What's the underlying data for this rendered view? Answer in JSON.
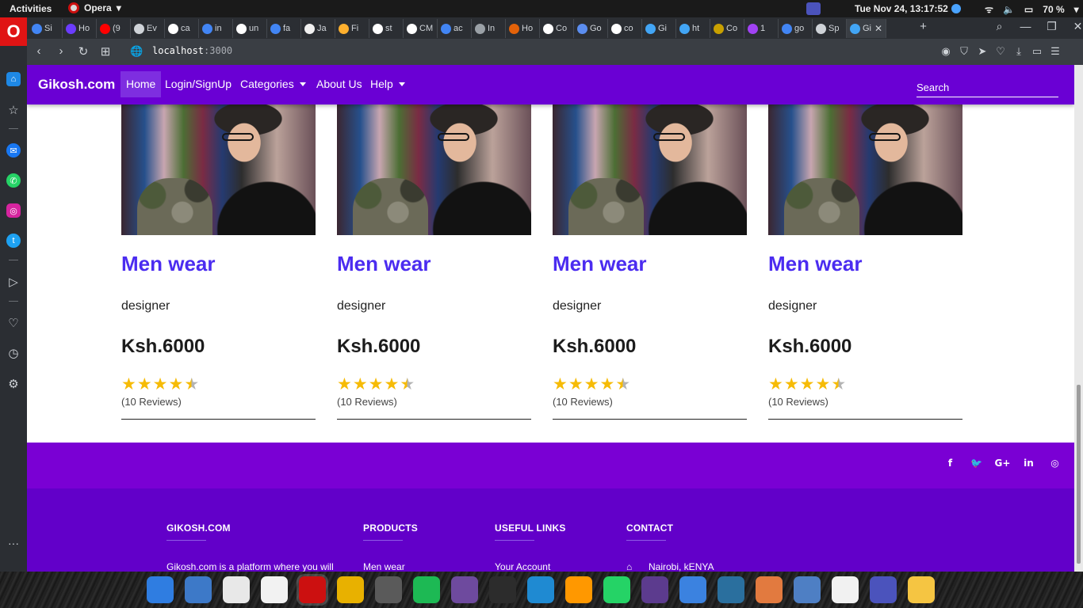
{
  "topbar": {
    "activities": "Activities",
    "app_menu": "Opera",
    "clock": "Tue Nov 24, 13:17:52",
    "battery": "70 %"
  },
  "browser": {
    "tabs": [
      {
        "label": "Si",
        "color": "#4285f4"
      },
      {
        "label": "Ho",
        "color": "#6b3cff"
      },
      {
        "label": "(9",
        "color": "#ff0000"
      },
      {
        "label": "Ev",
        "color": "#cfd3d8"
      },
      {
        "label": "ca",
        "color": "#ffffff"
      },
      {
        "label": "in",
        "color": "#4285f4"
      },
      {
        "label": "un",
        "color": "#ffffff"
      },
      {
        "label": "fa",
        "color": "#4285f4"
      },
      {
        "label": "Ja",
        "color": "#f0f0f0"
      },
      {
        "label": "Fi",
        "color": "#ffb02e"
      },
      {
        "label": "st",
        "color": "#ffffff"
      },
      {
        "label": "CM",
        "color": "#ffffff"
      },
      {
        "label": "ac",
        "color": "#4285f4"
      },
      {
        "label": "In",
        "color": "#9aa0a6"
      },
      {
        "label": "Ho",
        "color": "#e36209"
      },
      {
        "label": "Co",
        "color": "#ffffff"
      },
      {
        "label": "Go",
        "color": "#5b8def"
      },
      {
        "label": "co",
        "color": "#ffffff"
      },
      {
        "label": "Gi",
        "color": "#42a5f5"
      },
      {
        "label": "ht",
        "color": "#42a5f5"
      },
      {
        "label": "Co",
        "color": "#c8a000"
      },
      {
        "label": "1",
        "color": "#a142f4"
      },
      {
        "label": "go",
        "color": "#4285f4"
      },
      {
        "label": "Sp",
        "color": "#cfd3d8"
      },
      {
        "label": "Gi",
        "color": "#42a5f5",
        "active": true
      }
    ],
    "url_host": "localhost",
    "url_port": ":3000"
  },
  "site": {
    "brand": "Gikosh.com",
    "nav": {
      "home": "Home",
      "login": "Login/SignUp",
      "categories": "Categories",
      "about": "About Us",
      "help": "Help"
    },
    "search_placeholder": "Search",
    "products": [
      {
        "name": "Men wear",
        "description": "designer",
        "price": "Ksh.6000",
        "rating": 4.5,
        "reviews": "(10 Reviews)"
      },
      {
        "name": "Men wear",
        "description": "designer",
        "price": "Ksh.6000",
        "rating": 4.5,
        "reviews": "(10 Reviews)"
      },
      {
        "name": "Men wear",
        "description": "designer",
        "price": "Ksh.6000",
        "rating": 4.5,
        "reviews": "(10 Reviews)"
      },
      {
        "name": "Men wear",
        "description": "designer",
        "price": "Ksh.6000",
        "rating": 4.5,
        "reviews": "(10 Reviews)"
      }
    ],
    "social": {
      "facebook": "f",
      "twitter": "🐦",
      "google": "G+",
      "linkedin": "in",
      "instagram": "◎"
    },
    "footer": {
      "about": {
        "title": "GIKOSH.COM",
        "text": "Gikosh.com is a platform where you will"
      },
      "products": {
        "title": "PRODUCTS",
        "item": "Men wear"
      },
      "links": {
        "title": "USEFUL LINKS",
        "item": "Your Account"
      },
      "contact": {
        "title": "CONTACT",
        "item": "Nairobi, kENYA"
      }
    }
  },
  "dock": [
    {
      "name": "app-store",
      "color": "#2f7de1"
    },
    {
      "name": "files",
      "color": "#3d79c8"
    },
    {
      "name": "web-app",
      "color": "#e8e8e8"
    },
    {
      "name": "slack",
      "color": "#f2f2f2"
    },
    {
      "name": "opera",
      "color": "#cc1010",
      "active": true
    },
    {
      "name": "chrome",
      "color": "#e8b100"
    },
    {
      "name": "system-settings",
      "color": "#5a5a5a"
    },
    {
      "name": "spotify",
      "color": "#1db954"
    },
    {
      "name": "github-desktop",
      "color": "#6e4a9e"
    },
    {
      "name": "terminal",
      "color": "#2c2c2c"
    },
    {
      "name": "vscode",
      "color": "#1f8ad2"
    },
    {
      "name": "sublime",
      "color": "#ff9800"
    },
    {
      "name": "whatsapp",
      "color": "#25d366"
    },
    {
      "name": "3d-app",
      "color": "#5c3b8e"
    },
    {
      "name": "dash",
      "color": "#3b82e0"
    },
    {
      "name": "mysql-workbench",
      "color": "#2a6f9e"
    },
    {
      "name": "color-picker",
      "color": "#e27a3f"
    },
    {
      "name": "notes",
      "color": "#4e7fc4"
    },
    {
      "name": "google-drive",
      "color": "#f1f1f1"
    },
    {
      "name": "teams",
      "color": "#4b53bc"
    },
    {
      "name": "text-editor",
      "color": "#f5c542"
    }
  ]
}
